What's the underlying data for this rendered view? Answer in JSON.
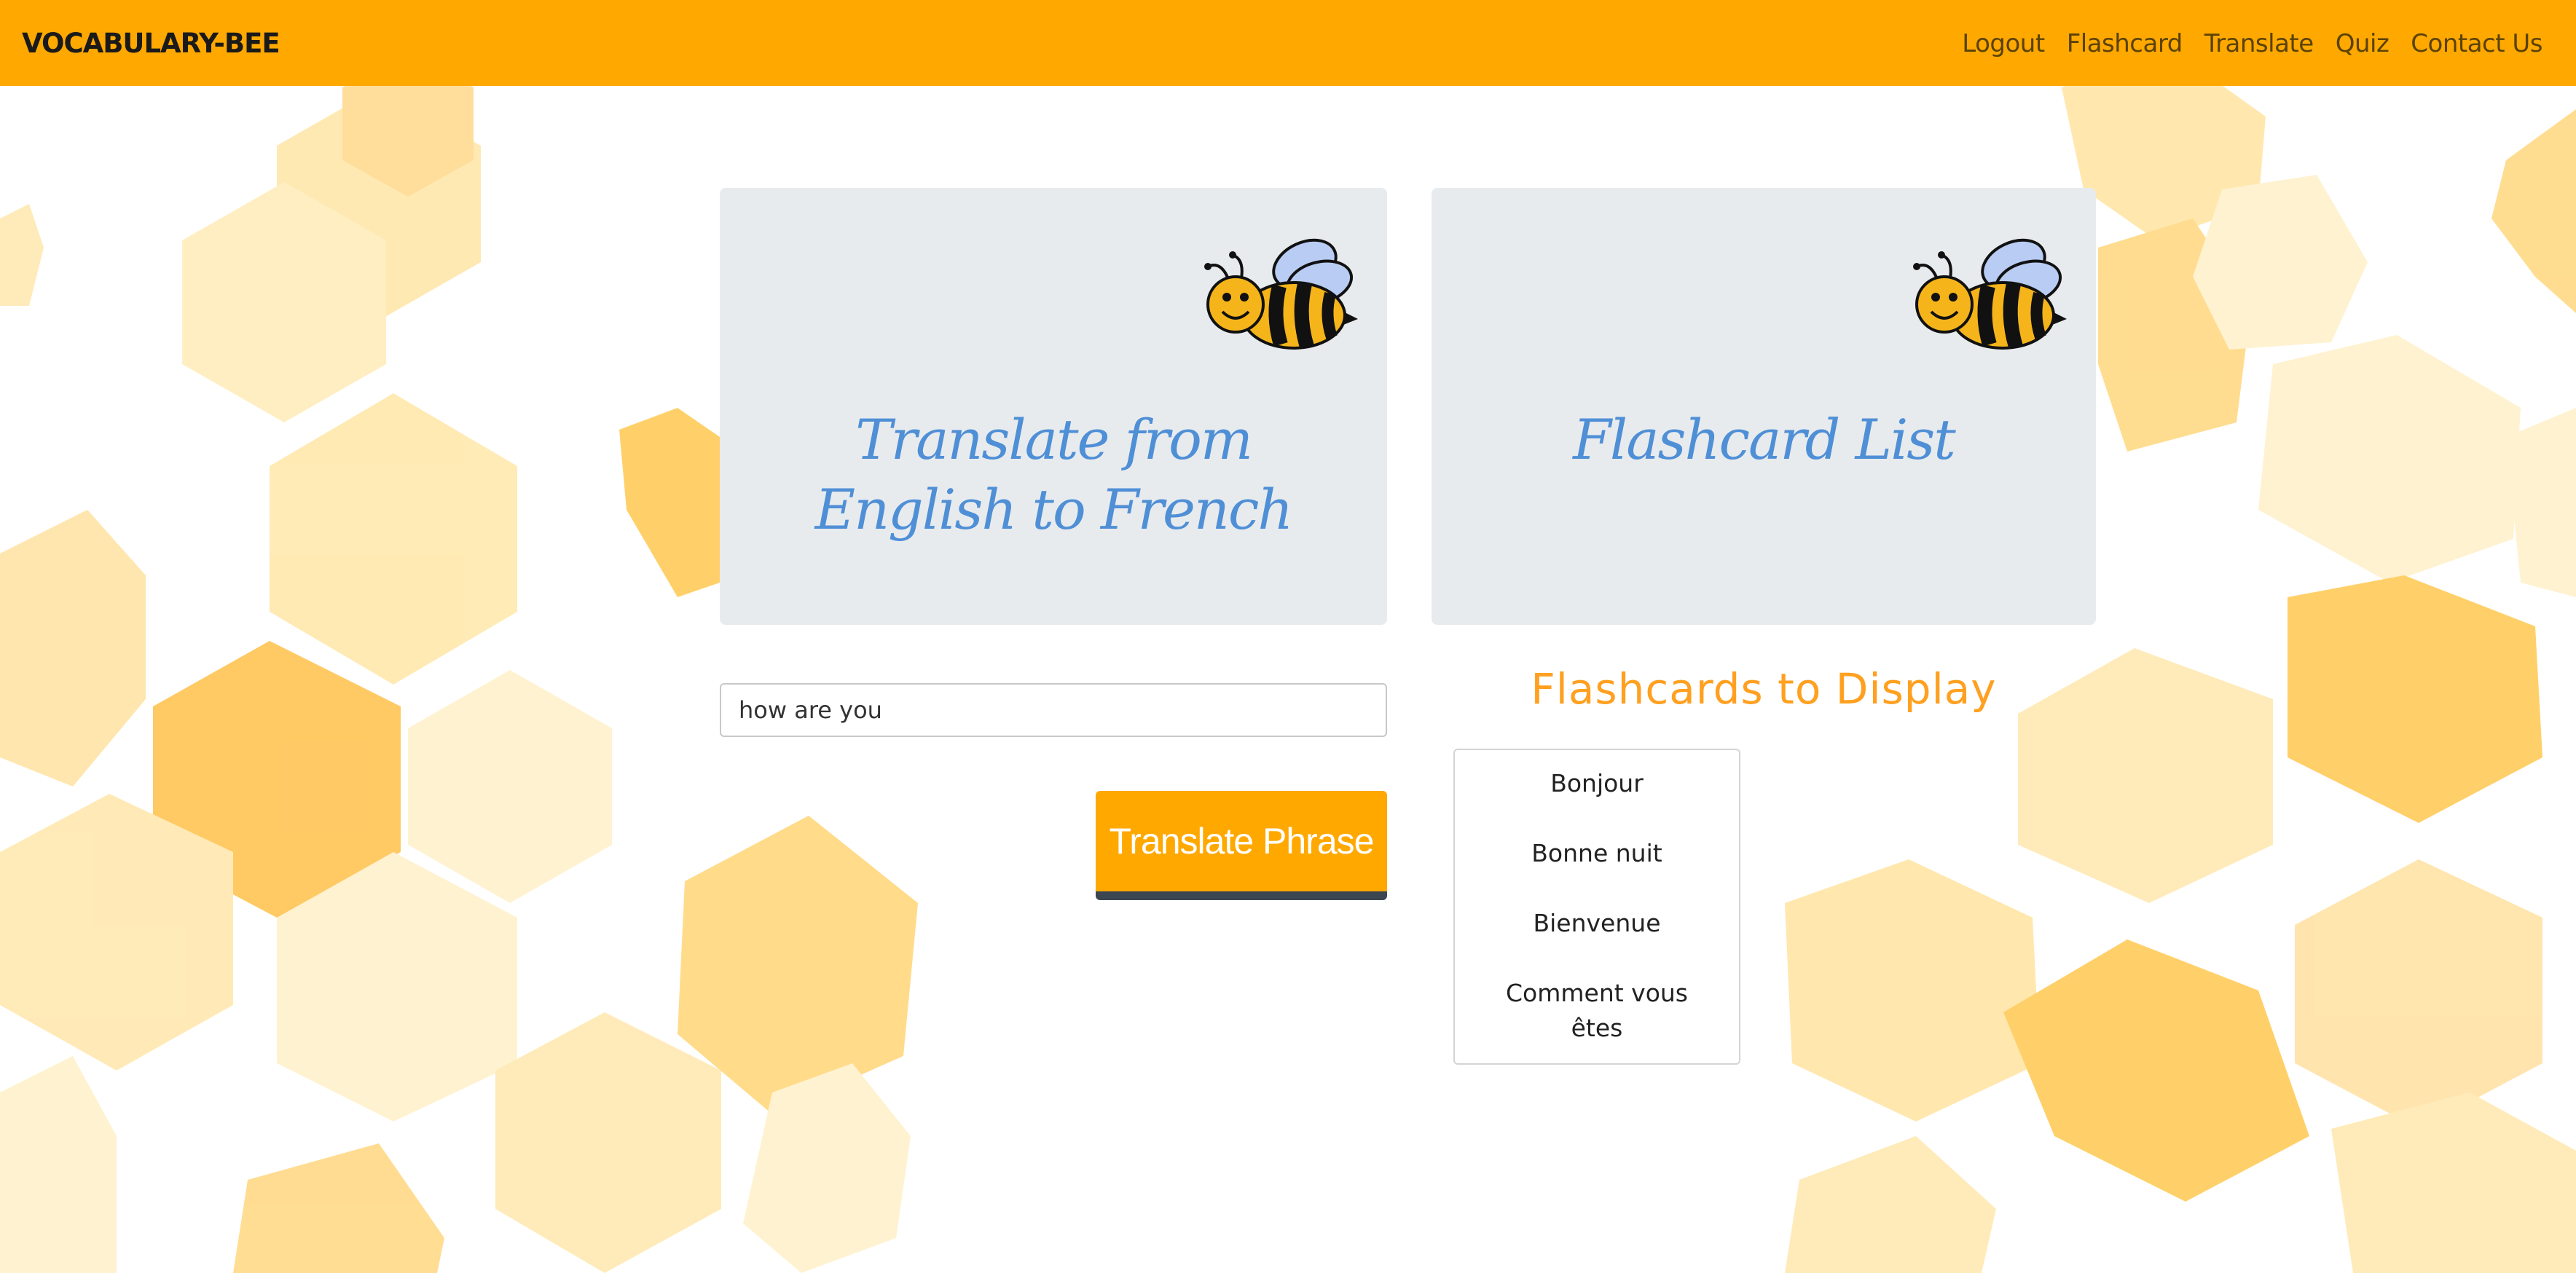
{
  "navbar": {
    "brand": "VOCABULARY-BEE",
    "links": [
      "Logout",
      "Flashcard",
      "Translate",
      "Quiz",
      "Contact Us"
    ]
  },
  "panels": {
    "translate_title": "Translate from English to French",
    "flashcard_title": "Flashcard List"
  },
  "translate": {
    "input_value": "how are you",
    "button_label": "Translate Phrase"
  },
  "flashcards": {
    "heading": "Flashcards to Display",
    "items": [
      "Bonjour",
      "Bonne nuit",
      "Bienvenue",
      "Comment vous êtes"
    ]
  },
  "colors": {
    "accent": "#ffa800",
    "title_blue": "#4f8fd6",
    "panel_bg": "#e8ebee",
    "button_shadow": "#3b4650"
  },
  "icons": [
    "bee-icon",
    "honeycomb-background"
  ]
}
